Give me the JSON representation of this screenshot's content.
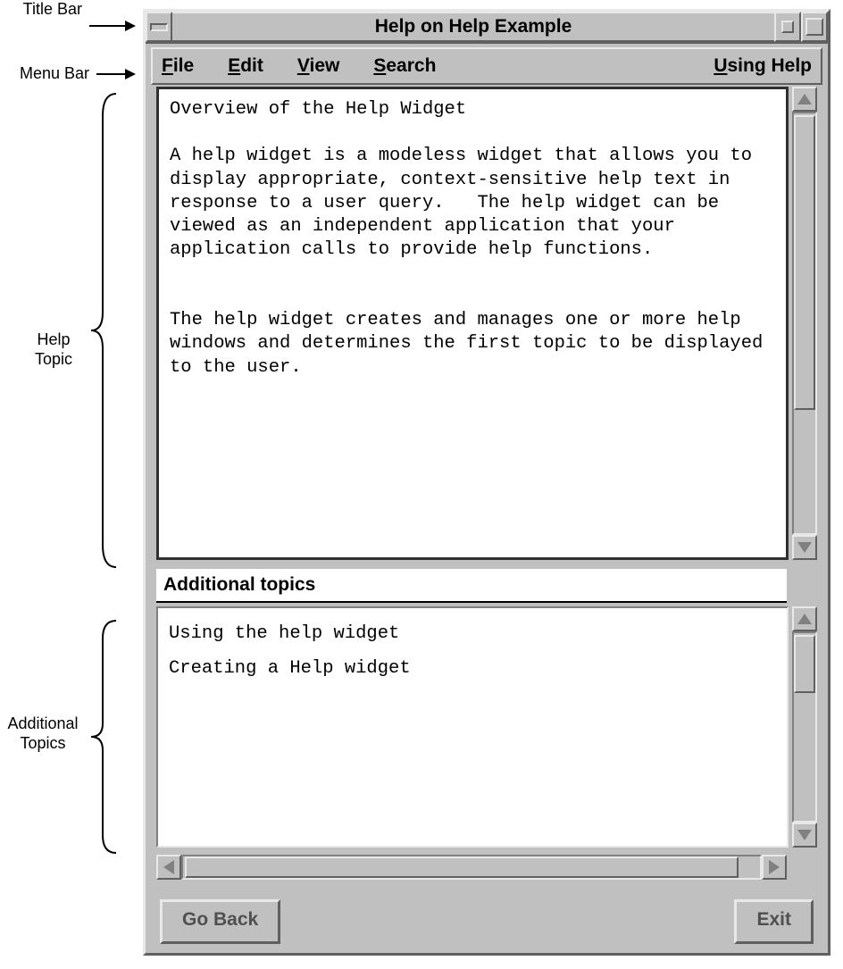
{
  "callouts": {
    "title_bar": "Title Bar",
    "menu_bar": "Menu Bar",
    "help_topic_l1": "Help",
    "help_topic_l2": "Topic",
    "additional_topics_l1": "Additional",
    "additional_topics_l2": "Topics"
  },
  "titlebar": {
    "title": "Help on Help Example"
  },
  "menu": {
    "file": "File",
    "edit": "Edit",
    "view": "View",
    "search": "Search",
    "using_help": "Using Help"
  },
  "help_topic": {
    "heading": "Overview of the Help Widget",
    "para1": "A help widget is a modeless widget that allows you to display appropriate, context-sensitive help text in response to a user query.   The help widget can be viewed as an independent application that your application calls to provide help functions.",
    "para2": "The help widget creates and manages one or more help windows and determines the first topic to be displayed to the user."
  },
  "additional": {
    "heading": "Additional topics",
    "items": [
      "Using the help widget",
      "Creating a Help widget"
    ]
  },
  "buttons": {
    "go_back": "Go Back",
    "exit": "Exit"
  }
}
